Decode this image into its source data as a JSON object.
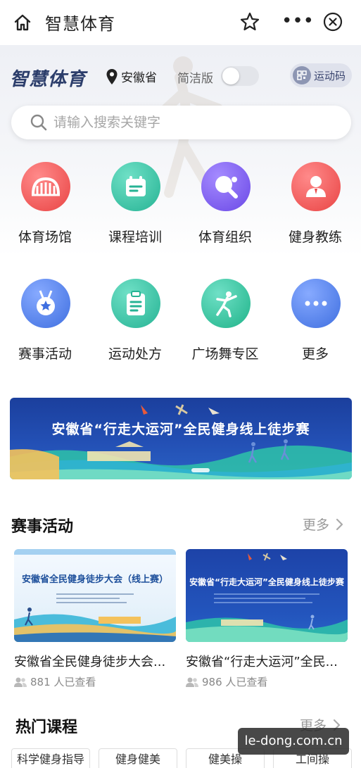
{
  "topbar": {
    "title": "智慧体育"
  },
  "header": {
    "brand": "智慧体育",
    "location": "安徽省",
    "simple_mode_label": "简洁版",
    "simple_mode_on": false,
    "sport_code_label": "运动码"
  },
  "search": {
    "placeholder": "请输入搜索关键字"
  },
  "grid": {
    "items": [
      {
        "label": "体育场馆",
        "icon": "stadium-icon",
        "color": "#ef5a5a"
      },
      {
        "label": "课程培训",
        "icon": "calendar-icon",
        "color": "#35c3a5"
      },
      {
        "label": "体育组织",
        "icon": "table-tennis-icon",
        "color": "#7a5cf0"
      },
      {
        "label": "健身教练",
        "icon": "coach-icon",
        "color": "#ef5a5a"
      },
      {
        "label": "赛事活动",
        "icon": "medal-icon",
        "color": "#4e7ee8"
      },
      {
        "label": "运动处方",
        "icon": "prescription-icon",
        "color": "#35c3a5"
      },
      {
        "label": "广场舞专区",
        "icon": "dancer-icon",
        "color": "#2ec39a"
      },
      {
        "label": "更多",
        "icon": "more-icon",
        "color": "#4e7ee8"
      }
    ]
  },
  "banner": {
    "text": "安徽省“行走大运河”全民健身线上徒步赛"
  },
  "events": {
    "title": "赛事活动",
    "more": "更多",
    "cards": [
      {
        "title": "安徽省全民健身徒步大会...",
        "views": "881 人已查看",
        "thumb_text": "安徽省全民健身徒步大会（线上赛）"
      },
      {
        "title": "安徽省“行走大运河”全民...",
        "views": "986 人已查看",
        "thumb_text": "安徽省“行走大运河”全民健身线上徒步赛"
      }
    ]
  },
  "courses": {
    "title": "热门课程",
    "more": "更多",
    "tags": [
      "科学健身指导",
      "健身健美",
      "健美操",
      "工间操"
    ]
  },
  "watermark": "le-dong.com.cn"
}
